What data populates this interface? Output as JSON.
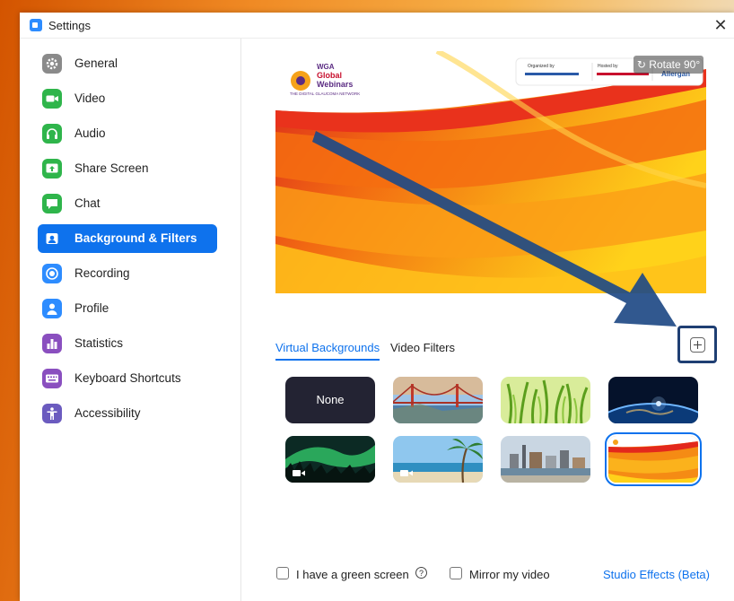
{
  "window": {
    "title": "Settings",
    "close_glyph": "✕"
  },
  "sidebar": {
    "items": [
      {
        "label": "General",
        "icon": "gear-icon",
        "color": "#7d7d7d",
        "active": false
      },
      {
        "label": "Video",
        "icon": "video-camera-icon",
        "color": "#2fb54b",
        "active": false
      },
      {
        "label": "Audio",
        "icon": "headphones-icon",
        "color": "#2fb54b",
        "active": false
      },
      {
        "label": "Share Screen",
        "icon": "share-screen-icon",
        "color": "#2fb54b",
        "active": false
      },
      {
        "label": "Chat",
        "icon": "chat-bubble-icon",
        "color": "#2fb54b",
        "active": false
      },
      {
        "label": "Background & Filters",
        "icon": "background-person-icon",
        "color": "#0e72ed",
        "active": true
      },
      {
        "label": "Recording",
        "icon": "record-icon",
        "color": "#2d8cff",
        "active": false
      },
      {
        "label": "Profile",
        "icon": "person-icon",
        "color": "#2d8cff",
        "active": false
      },
      {
        "label": "Statistics",
        "icon": "bar-chart-icon",
        "color": "#8a4fbf",
        "active": false
      },
      {
        "label": "Keyboard Shortcuts",
        "icon": "keyboard-icon",
        "color": "#8a4fbf",
        "active": false
      },
      {
        "label": "Accessibility",
        "icon": "accessibility-icon",
        "color": "#6b5bbf",
        "active": false
      }
    ]
  },
  "preview": {
    "rotate_label": "Rotate 90°",
    "logo_line1": "WGA",
    "logo_line2": "Global",
    "logo_line3": "Webinars",
    "logo_tagline": "THE DIGITAL GLAUCOMA NETWORK",
    "organized_by": "Organized by",
    "hosted_by": "Hosted by",
    "sponsor": "Allergan"
  },
  "tabs": [
    {
      "label": "Virtual Backgrounds",
      "active": true
    },
    {
      "label": "Video Filters",
      "active": false
    }
  ],
  "thumbnails": {
    "none_label": "None",
    "items": [
      "none",
      "golden-gate-bridge",
      "grass",
      "earth-from-space",
      "aurora",
      "beach-palm",
      "city-waterfront",
      "custom-orange-webinar"
    ]
  },
  "footer": {
    "green_screen_label": "I have a green screen",
    "help_glyph": "?",
    "mirror_label": "Mirror my video",
    "studio_effects_label": "Studio Effects (Beta)"
  },
  "colors": {
    "accent": "#0e72ed",
    "highlight_box": "#1f3f73",
    "arrow": "#1f4a86"
  }
}
